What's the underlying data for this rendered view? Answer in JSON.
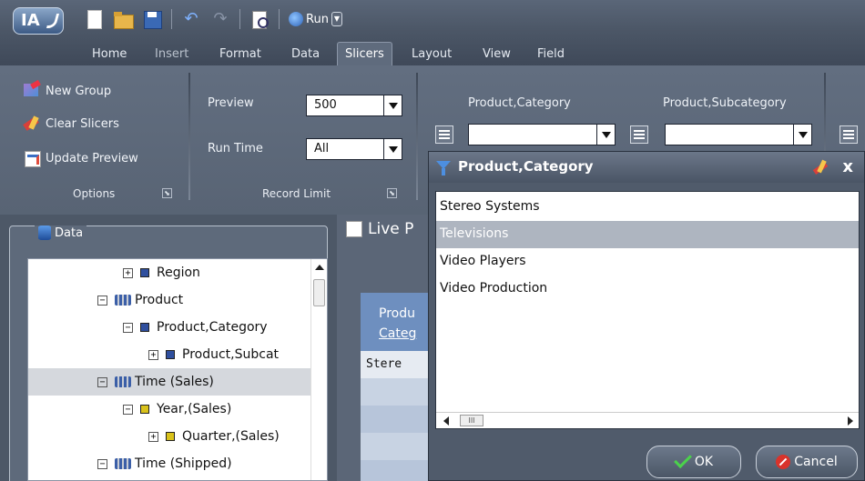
{
  "app": {
    "logo_text": "IA"
  },
  "qat": {
    "run_label": "Run"
  },
  "tabs": [
    {
      "label": "Home",
      "state": "normal"
    },
    {
      "label": "Insert",
      "state": "disabled"
    },
    {
      "label": "Format",
      "state": "normal"
    },
    {
      "label": "Data",
      "state": "normal"
    },
    {
      "label": "Slicers",
      "state": "active"
    },
    {
      "label": "Layout",
      "state": "normal"
    },
    {
      "label": "View",
      "state": "normal"
    },
    {
      "label": "Field",
      "state": "normal"
    }
  ],
  "ribbon": {
    "options": {
      "new_group": "New Group",
      "clear_slicers": "Clear Slicers",
      "update_preview": "Update Preview",
      "group_label": "Options"
    },
    "record_limit": {
      "preview_label": "Preview",
      "preview_value": "500",
      "runtime_label": "Run Time",
      "runtime_value": "All",
      "group_label": "Record Limit"
    },
    "slicers": {
      "slicer1_label": "Product,Category",
      "slicer1_value": "",
      "slicer2_label": "Product,Subcategory",
      "slicer2_value": ""
    }
  },
  "data_panel": {
    "title": "Data",
    "tree": [
      {
        "label": "Region",
        "expander": "+",
        "icon": "blue-square"
      },
      {
        "label": "Product",
        "expander": "-",
        "icon": "dimension"
      },
      {
        "label": "Product,Category",
        "expander": "-",
        "icon": "blue-square"
      },
      {
        "label": "Product,Subcat",
        "expander": "+",
        "icon": "blue-square"
      },
      {
        "label": "Time (Sales)",
        "expander": "-",
        "icon": "dimension",
        "selected": true
      },
      {
        "label": "Year,(Sales)",
        "expander": "-",
        "icon": "yellow-square"
      },
      {
        "label": "Quarter,(Sales)",
        "expander": "+",
        "icon": "yellow-square"
      },
      {
        "label": "Time (Shipped)",
        "expander": "-",
        "icon": "dimension"
      }
    ]
  },
  "live_preview": {
    "title": "Live P",
    "header_line1": "Produ",
    "header_line2": "Categ",
    "cell": "Stere"
  },
  "dialog": {
    "title": "Product,Category",
    "close": "x",
    "items": [
      {
        "label": "Stereo Systems",
        "selected": false
      },
      {
        "label": "Televisions",
        "selected": true
      },
      {
        "label": "Video Players",
        "selected": false
      },
      {
        "label": "Video Production",
        "selected": false
      }
    ],
    "ok_label": "OK",
    "cancel_label": "Cancel"
  }
}
